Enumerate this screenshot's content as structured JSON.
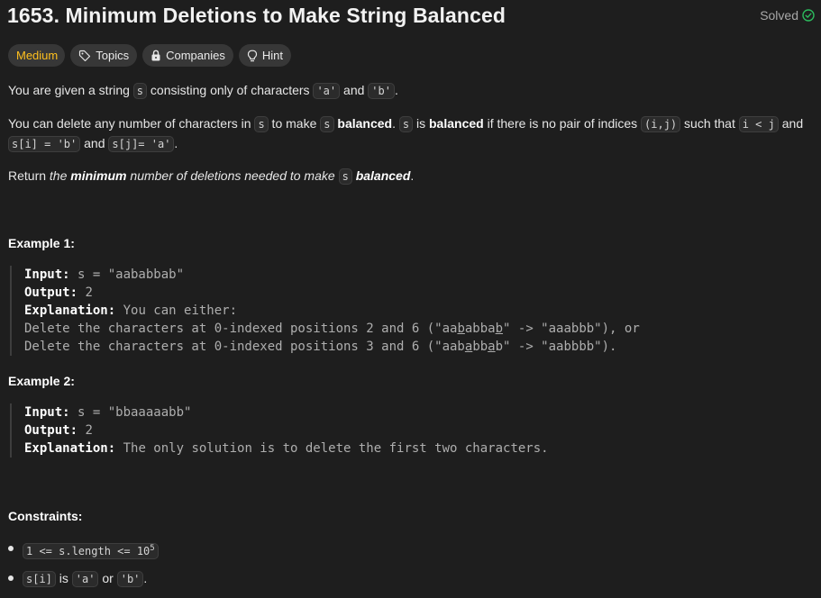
{
  "problem": {
    "title": "1653. Minimum Deletions to Make String Balanced",
    "status": "Solved",
    "difficulty": "Medium",
    "tags": {
      "topics": "Topics",
      "companies": "Companies",
      "hint": "Hint"
    }
  },
  "description": {
    "p1": {
      "a": "You are given a string ",
      "c1": "s",
      "b": " consisting only of characters ",
      "c2": "'a'",
      "c": " and ",
      "c3": "'b'",
      "d": "."
    },
    "p2": {
      "a": "You can delete any number of characters in ",
      "c1": "s",
      "b": " to make ",
      "c2": "s",
      "bold1": "balanced",
      "c": ". ",
      "c3": "s",
      "d": " is ",
      "bold2": "balanced",
      "e": " if there is no pair of indices ",
      "c4": "(i,j)",
      "f": " such that ",
      "c5": "i < j",
      "g": " and",
      "line2_c1": "s[i] = 'b'",
      "line2_a": " and ",
      "line2_c2": "s[j]= 'a'",
      "line2_b": "."
    },
    "p3": {
      "a": "Return ",
      "i1": "the ",
      "bi": "minimum",
      "i2": " number of deletions needed to make ",
      "c1": "s",
      "sp": " ",
      "bi2": "balanced",
      "end": "."
    }
  },
  "examples": [
    {
      "heading": "Example 1:",
      "input_label": "Input:",
      "input": " s = \"aababbab\"",
      "output_label": "Output:",
      "output": " 2",
      "explanation_label": "Explanation:",
      "explanation": " You can either:",
      "line1_a": "Delete the characters at 0-indexed positions 2 and 6 (\"aa",
      "line1_u1": "b",
      "line1_b": "abba",
      "line1_u2": "b",
      "line1_c": "\" -> \"aaabbb\"), or",
      "line2_a": "Delete the characters at 0-indexed positions 3 and 6 (\"aab",
      "line2_u1": "a",
      "line2_b": "bb",
      "line2_u2": "a",
      "line2_c": "b\" -> \"aabbbb\")."
    },
    {
      "heading": "Example 2:",
      "input_label": "Input:",
      "input": " s = \"bbaaaaabb\"",
      "output_label": "Output:",
      "output": " 2",
      "explanation_label": "Explanation:",
      "explanation": " The only solution is to delete the first two characters."
    }
  ],
  "constraints": {
    "heading": "Constraints:",
    "c1_code": "1 <= s.length <= 10",
    "c1_sup": "5",
    "c2_code1": "s[i]",
    "c2_a": " is ",
    "c2_code2": "'a'",
    "c2_b": " or ",
    "c2_code3": "'b'",
    "c2_c": "."
  },
  "colors": {
    "background": "#1e1e1e",
    "medium": "#ffc01e",
    "solved_check": "#2cbb5d"
  },
  "icons": [
    "check-circle-icon",
    "tag-icon",
    "lock-icon",
    "lightbulb-icon"
  ]
}
